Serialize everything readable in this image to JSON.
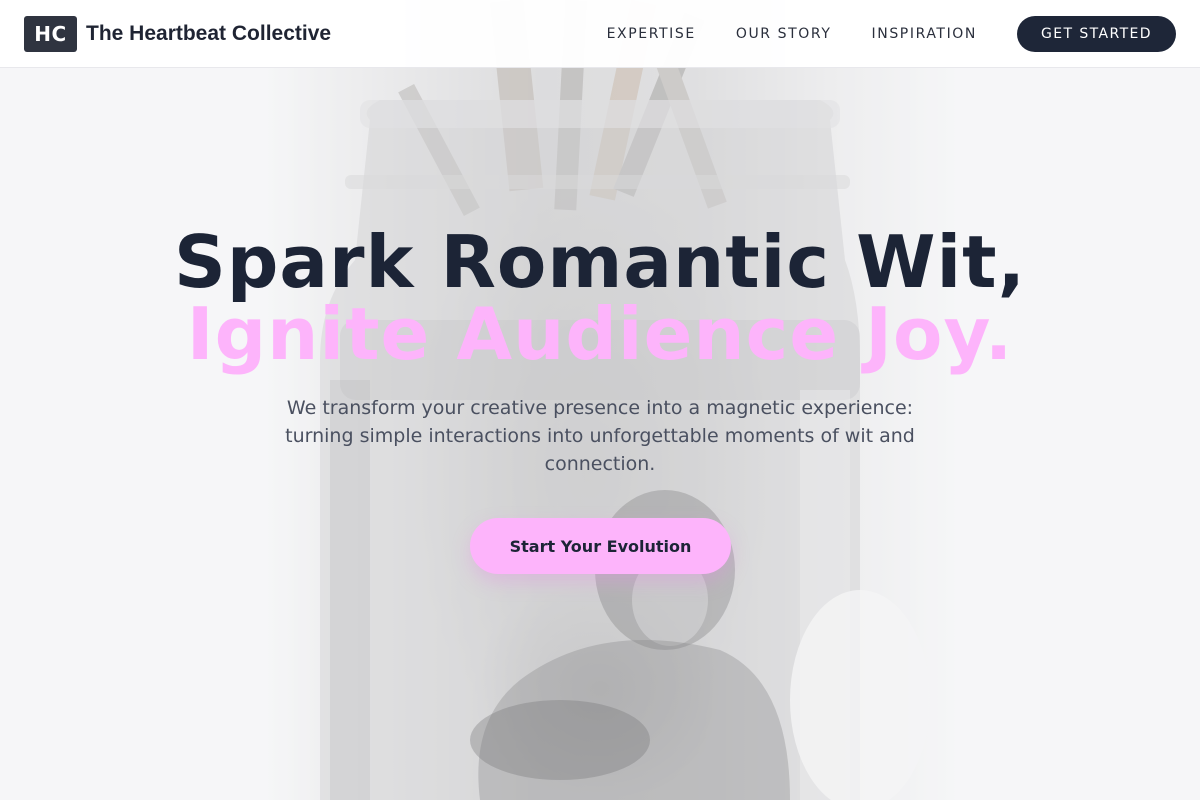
{
  "brand": {
    "logo_text": "HC",
    "name": "The Heartbeat Collective"
  },
  "nav": {
    "links": [
      "EXPERTISE",
      "OUR STORY",
      "INSPIRATION"
    ],
    "cta_label": "GET STARTED"
  },
  "hero": {
    "headline_line1": "Spark Romantic Wit,",
    "headline_line2": "Ignite Audience Joy.",
    "subtitle": "We transform your creative presence into a magnetic experience: turning simple interactions into unforgettable moments of wit and connection.",
    "cta_label": "Start Your Evolution",
    "background_image": "jar-with-brushes-photo"
  },
  "colors": {
    "primary_dark": "#1e2638",
    "accent_pink": "#fdb4fb",
    "logo_bg": "#2f3440"
  }
}
